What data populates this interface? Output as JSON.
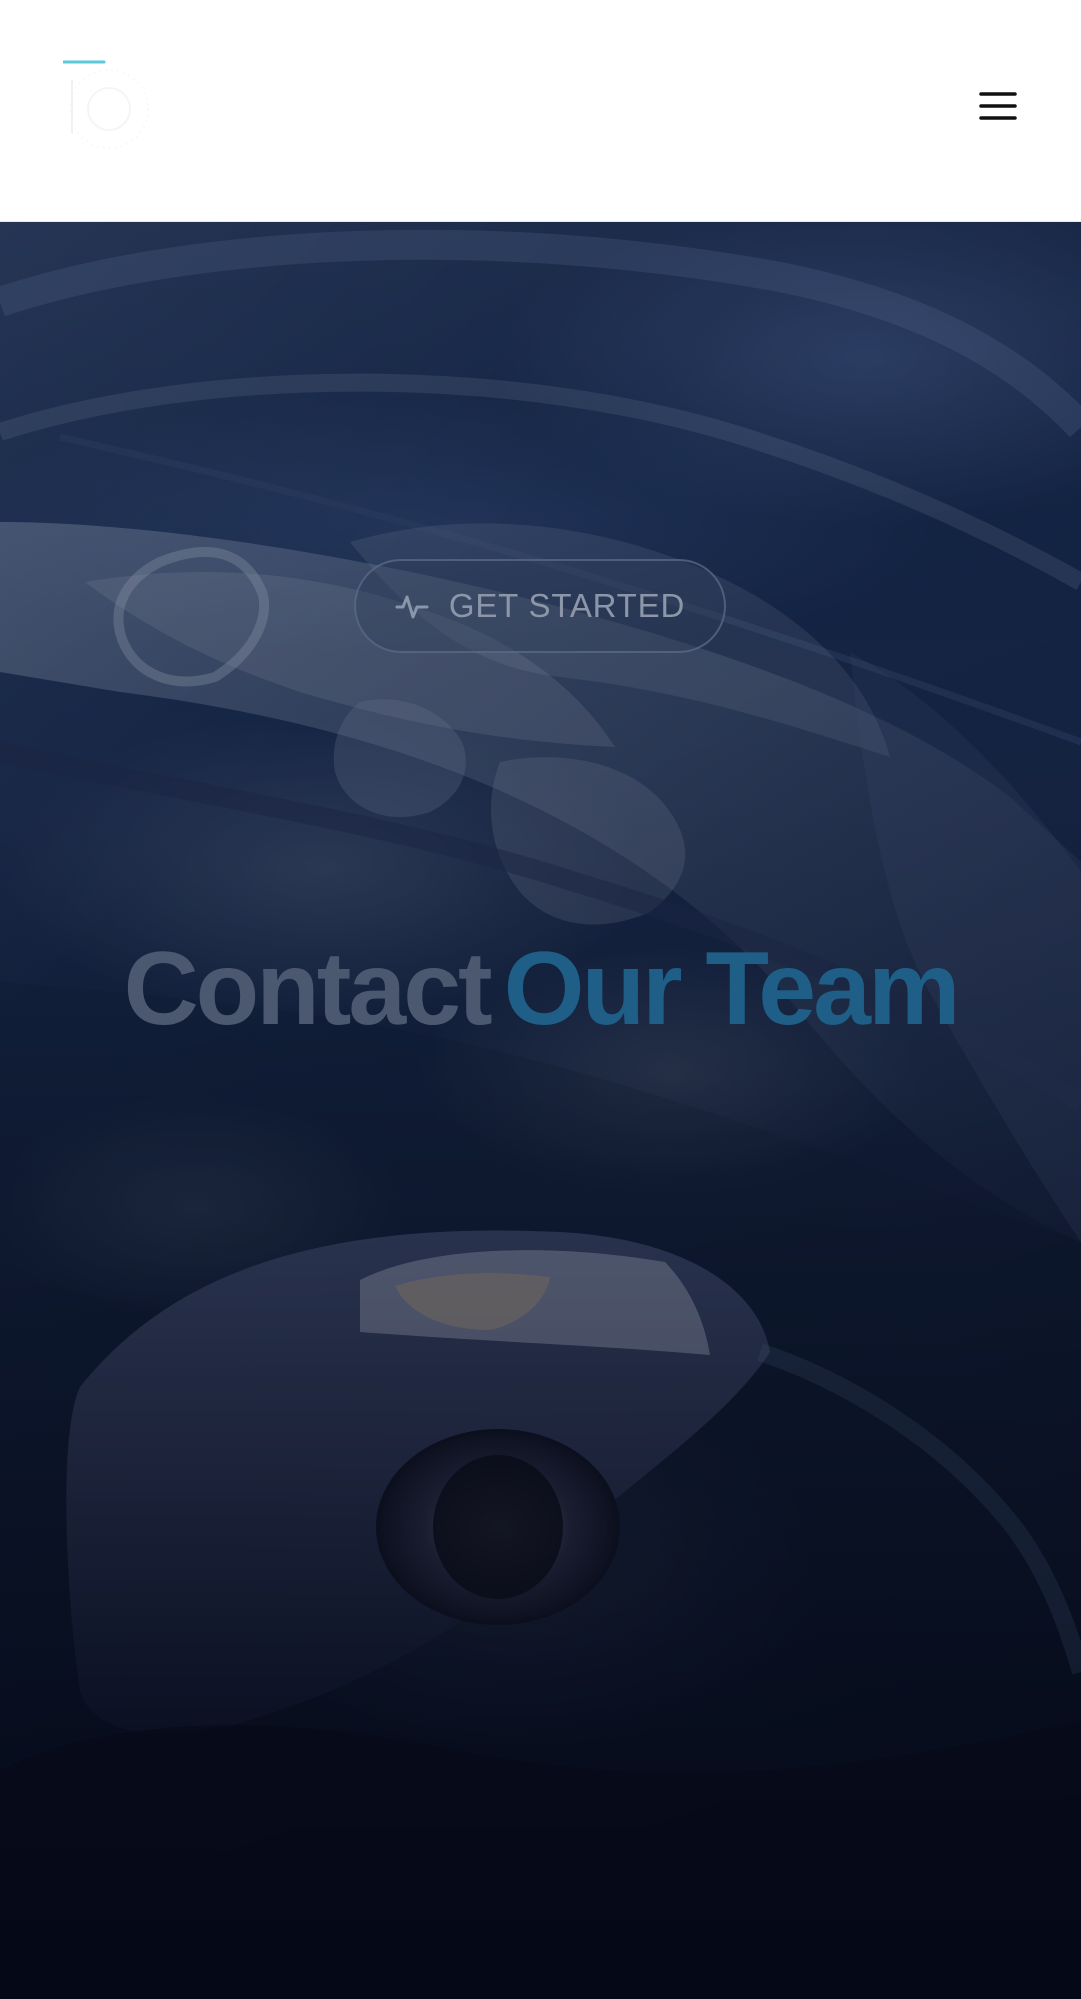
{
  "header": {
    "logo_icon": "circle-logo-icon",
    "menu_icon": "hamburger-menu-icon"
  },
  "hero": {
    "cta_icon": "activity-icon",
    "cta_label": "GET STARTED",
    "title_main": "Contact",
    "title_accent": "Our Team"
  },
  "colors": {
    "accent": "#5bc9da",
    "title_main": "#4b5870",
    "title_accent": "#1f5e87",
    "footer": "#050816"
  }
}
